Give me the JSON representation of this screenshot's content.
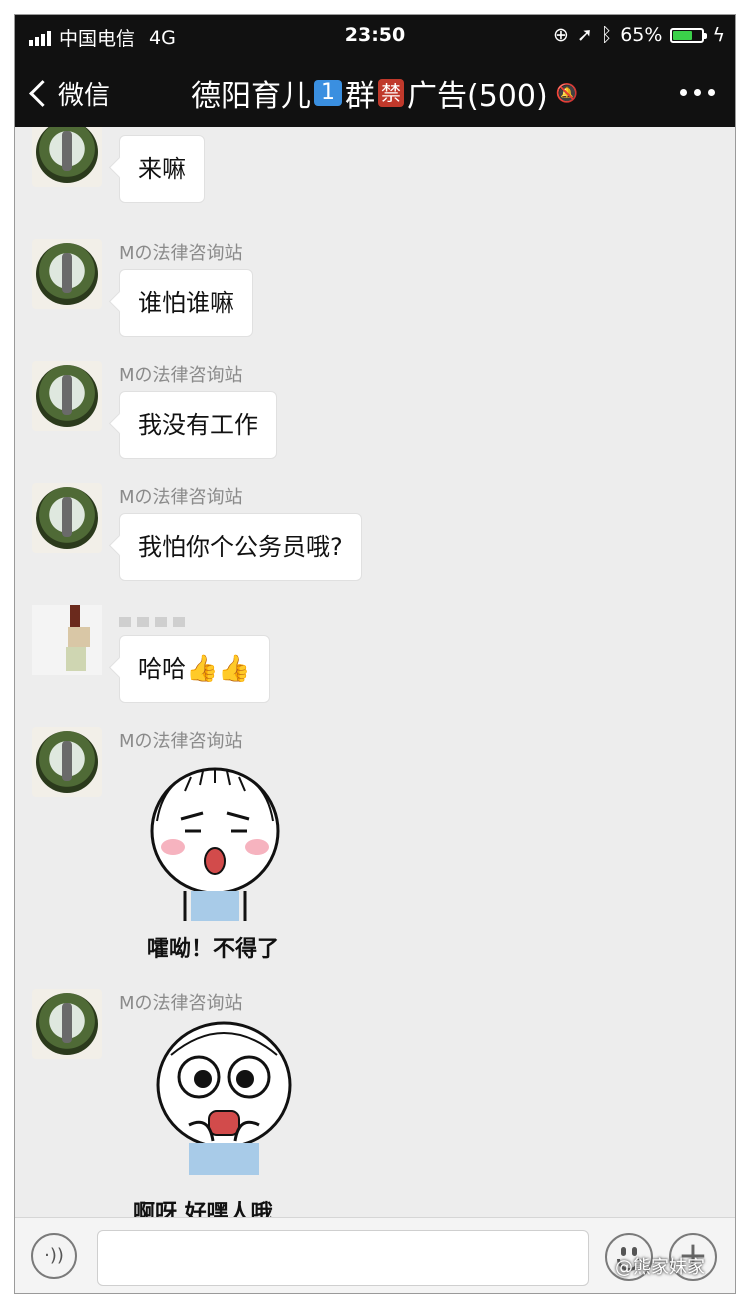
{
  "status_bar": {
    "carrier": "中国电信",
    "network": "4G",
    "time": "23:50",
    "battery_pct": "65%",
    "battery_level": 0.65,
    "icons": [
      "orientation-lock-icon",
      "location-icon",
      "bluetooth-icon",
      "charging-icon"
    ]
  },
  "nav": {
    "back_label": "微信",
    "title_prefix": "德阳育儿",
    "title_num": "1",
    "title_mid": "群",
    "title_badge": "禁",
    "title_suffix": "广告(500)"
  },
  "messages": [
    {
      "sender": "",
      "text": "来嘛"
    },
    {
      "sender": "Mの法律咨询站",
      "text": "谁怕谁嘛"
    },
    {
      "sender": "Mの法律咨询站",
      "text": "我没有工作"
    },
    {
      "sender": "Mの法律咨询站",
      "text": "我怕你个公务员哦?"
    },
    {
      "sender": "",
      "text": "哈哈",
      "emojis": [
        "👍",
        "👍"
      ]
    },
    {
      "sender": "Mの法律咨询站",
      "sticker_caption": "嚯呦！不得了"
    },
    {
      "sender": "Mの法律咨询站",
      "sticker_caption": "啊呀 好嘿人哦"
    }
  ],
  "watermark": "@熊家妹家",
  "colors": {
    "nav_bg": "#111111",
    "chat_bg": "#ededed",
    "battery_fill": "#3bd14a",
    "num_badge": "#3a8fe0",
    "ban_badge": "#c0392b"
  }
}
